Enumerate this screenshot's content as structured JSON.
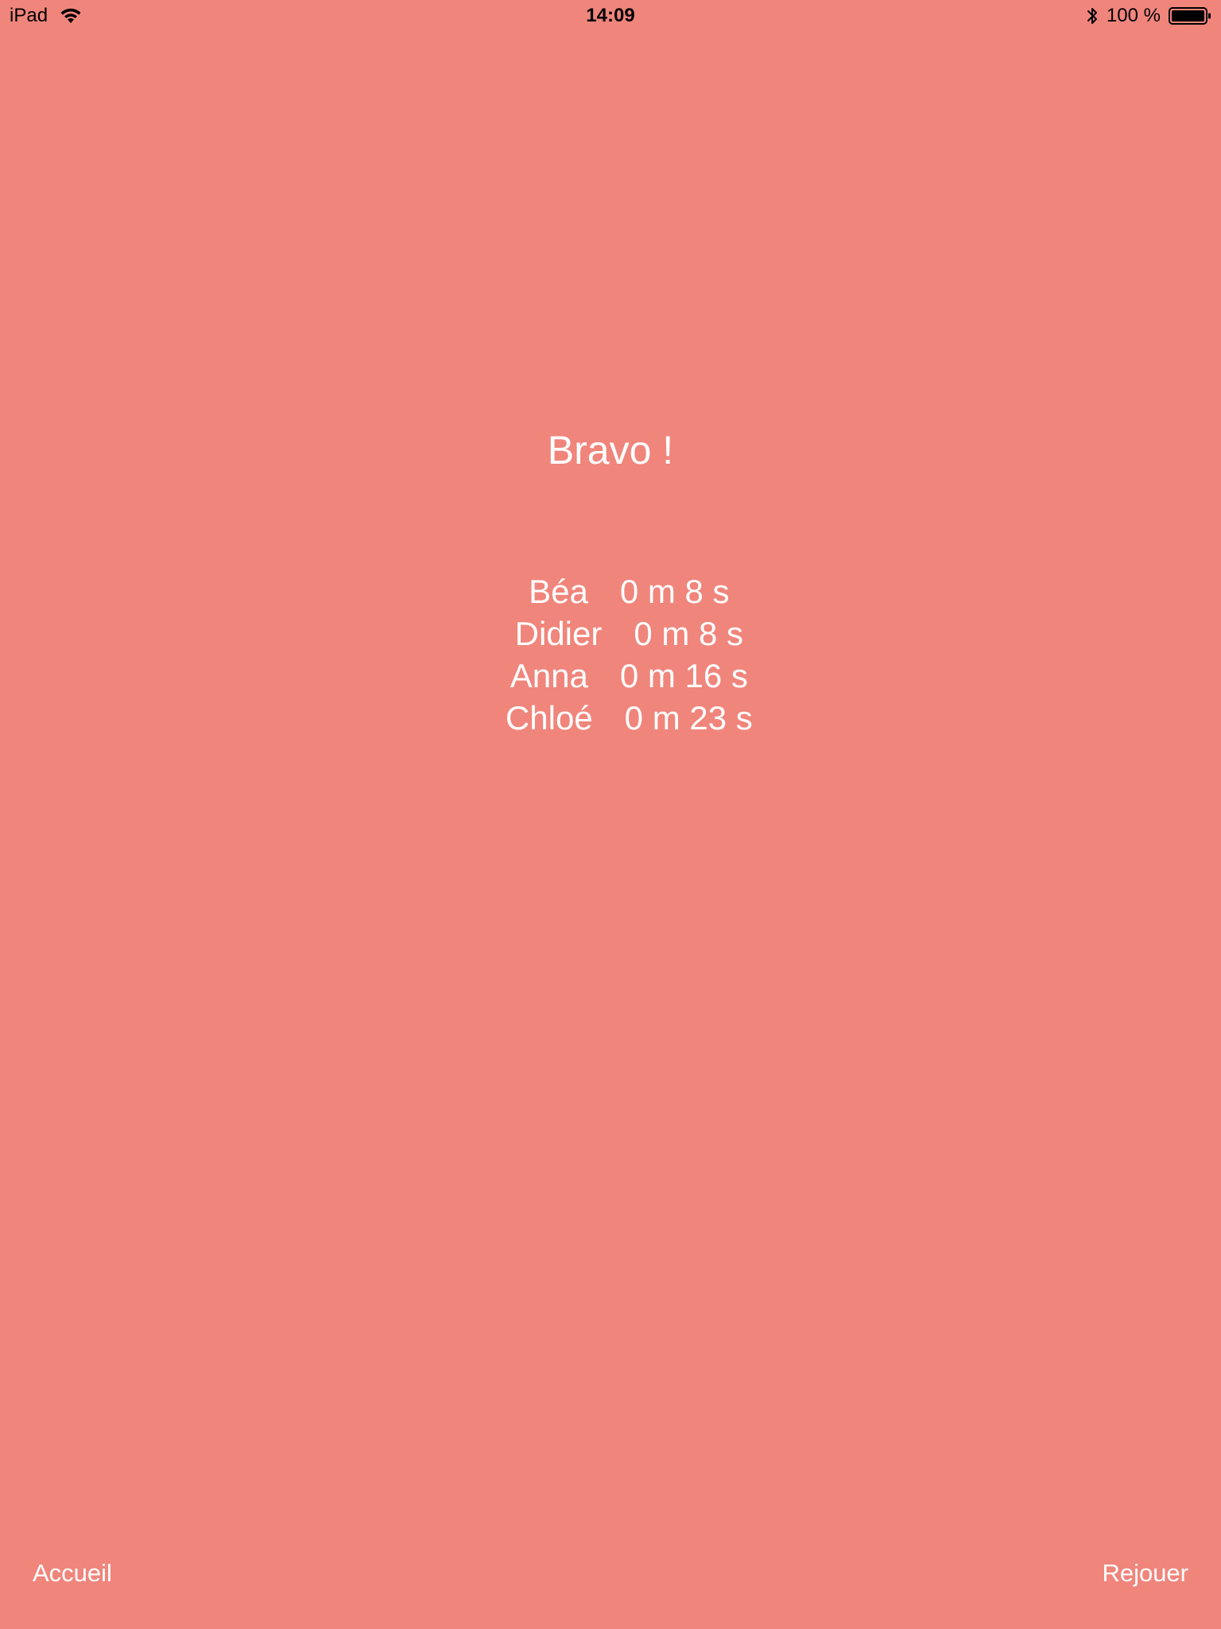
{
  "status_bar": {
    "device": "iPad",
    "time": "14:09",
    "battery": "100 %",
    "battery_level": 1.0,
    "icons": [
      "wifi-icon",
      "bluetooth-icon",
      "battery-icon"
    ]
  },
  "title": "Bravo !",
  "results": [
    {
      "name": "Béa",
      "time": "0 m 8 s"
    },
    {
      "name": "Didier",
      "time": "0 m 8 s"
    },
    {
      "name": "Anna",
      "time": "0 m 16 s"
    },
    {
      "name": "Chloé",
      "time": "0 m 23 s"
    }
  ],
  "buttons": {
    "home_label": "Accueil",
    "replay_label": "Rejouer"
  },
  "colors": {
    "background": "#F0857C",
    "text": "#FFFFFF",
    "status_text": "#000000"
  }
}
